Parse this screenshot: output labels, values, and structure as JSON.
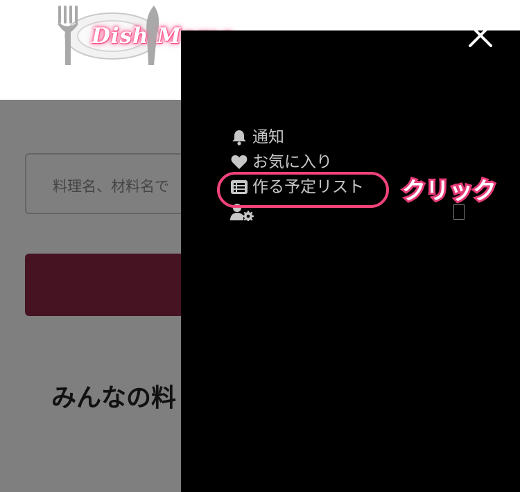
{
  "header": {
    "logo_text": "Dish Memo"
  },
  "search": {
    "placeholder": "料理名、材料名で"
  },
  "section": {
    "heading": "みんなの料"
  },
  "drawer": {
    "close_icon": "close-icon",
    "items": [
      {
        "label": "通知",
        "icon": "bell-icon"
      },
      {
        "label": "お気に入り",
        "icon": "heart-icon"
      },
      {
        "label": "作る予定リスト",
        "icon": "list-icon"
      },
      {
        "label": "",
        "icon": "user-settings-icon"
      }
    ]
  },
  "annotation": {
    "label": "クリック",
    "color": "#f0437a"
  },
  "colors": {
    "accent_button": "#8c2644",
    "drawer_bg": "#000000",
    "menu_text": "#c7c7c7"
  }
}
